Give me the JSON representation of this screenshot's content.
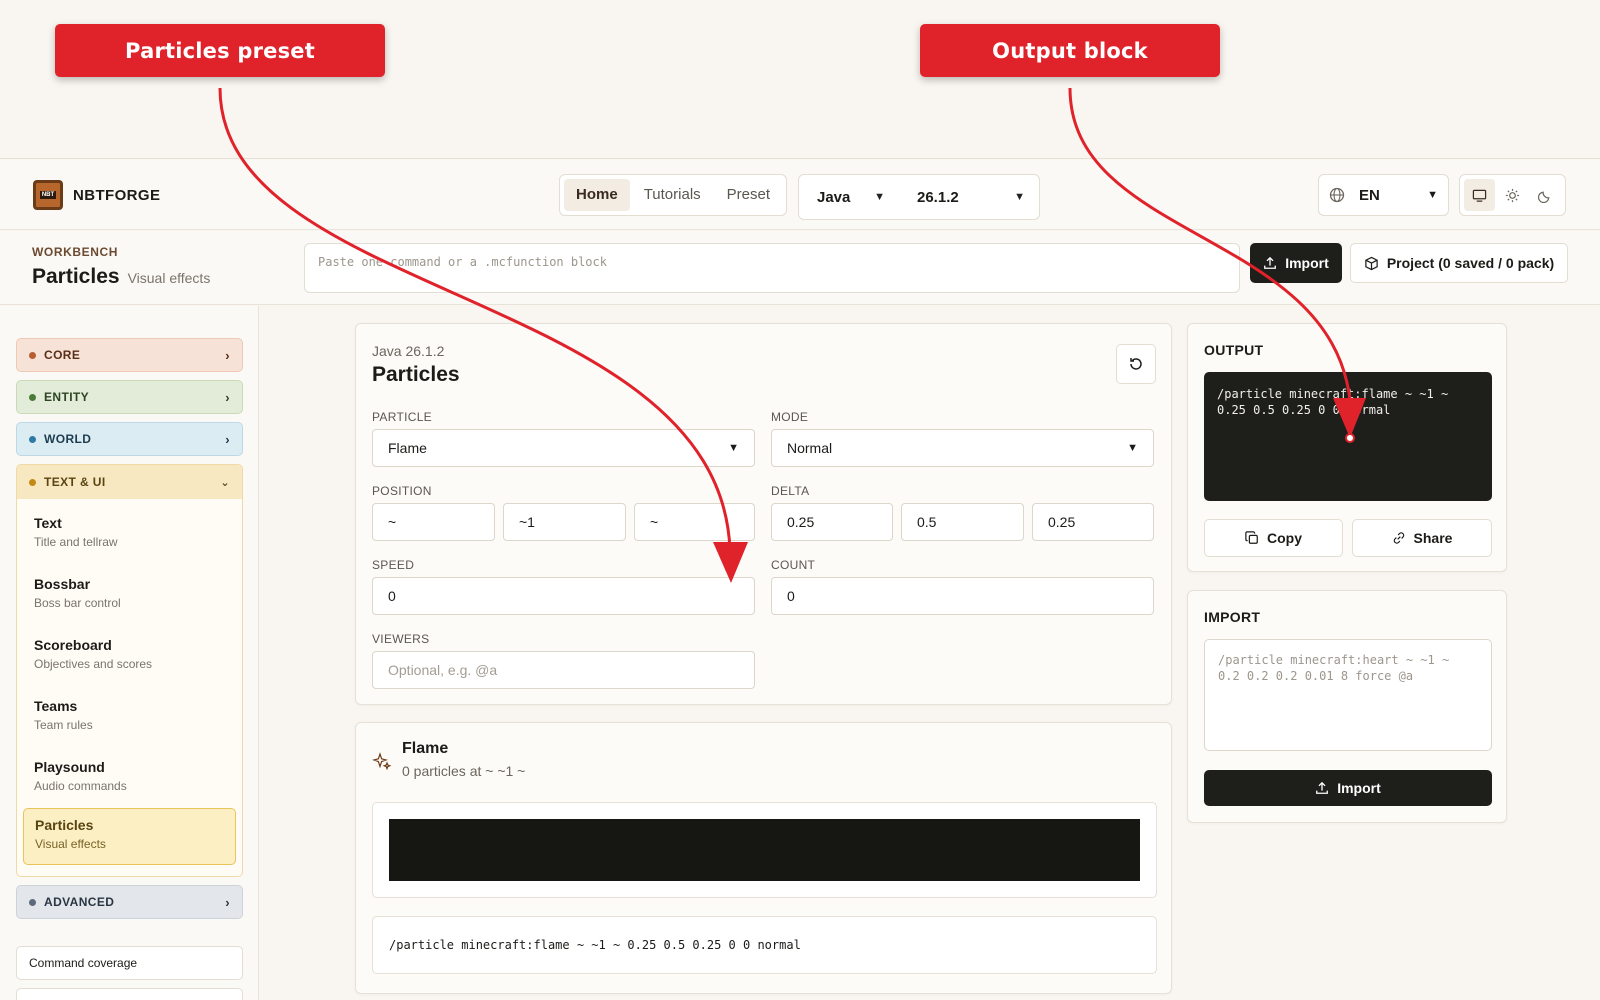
{
  "annotations": {
    "callout_1": "Particles preset",
    "callout_2": "Output block"
  },
  "colors": {
    "callout_red": "#e0222b",
    "dark": "#1e1e1b",
    "accent_brown": "#6b3a16"
  },
  "header": {
    "brand_logo_text": "NBT",
    "brand_name": "NBTFORGE",
    "nav_tabs": [
      {
        "label": "Home",
        "active": true
      },
      {
        "label": "Tutorials",
        "active": false
      },
      {
        "label": "Preset",
        "active": false
      }
    ],
    "edition": "Java",
    "version": "26.1.2",
    "language": "EN",
    "theme_modes": [
      "monitor-icon",
      "sun-icon",
      "moon-icon"
    ]
  },
  "workbench": {
    "label": "WORKBENCH",
    "title": "Particles",
    "subtitle": "Visual effects",
    "paste_placeholder": "Paste one command or a .mcfunction block",
    "import_label": "Import",
    "project_label": "Project (0 saved / 0 pack)"
  },
  "sidebar": {
    "categories": [
      {
        "label": "CORE"
      },
      {
        "label": "ENTITY"
      },
      {
        "label": "WORLD"
      },
      {
        "label": "TEXT & UI"
      },
      {
        "label": "ADVANCED"
      }
    ],
    "items": [
      {
        "name": "Text",
        "desc": "Title and tellraw"
      },
      {
        "name": "Bossbar",
        "desc": "Boss bar control"
      },
      {
        "name": "Scoreboard",
        "desc": "Objectives and scores"
      },
      {
        "name": "Teams",
        "desc": "Team rules"
      },
      {
        "name": "Playsound",
        "desc": "Audio commands"
      },
      {
        "name": "Particles",
        "desc": "Visual effects",
        "active": true
      }
    ],
    "footer_links": [
      "Command coverage",
      "Project (0 saved / 0 pack)"
    ]
  },
  "editor": {
    "version": "Java 26.1.2",
    "title": "Particles",
    "particle_label": "PARTICLE",
    "particle_value": "Flame",
    "mode_label": "MODE",
    "mode_value": "Normal",
    "position_label": "POSITION",
    "position": [
      "~",
      "~1",
      "~"
    ],
    "delta_label": "DELTA",
    "delta": [
      "0.25",
      "0.5",
      "0.25"
    ],
    "speed_label": "SPEED",
    "speed": "0",
    "count_label": "COUNT",
    "count": "0",
    "viewers_label": "VIEWERS",
    "viewers_placeholder": "Optional, e.g. @a"
  },
  "preview": {
    "title": "Flame",
    "subtitle": "0 particles at ~ ~1 ~",
    "command": "/particle minecraft:flame ~ ~1 ~ 0.25 0.5 0.25 0 0 normal"
  },
  "output": {
    "title": "OUTPUT",
    "code_line1": "/particle minecraft:flame ~ ~1 ~",
    "code_line2": "0.25 0.5 0.25 0 0 normal",
    "copy_label": "Copy",
    "share_label": "Share"
  },
  "import": {
    "title": "IMPORT",
    "placeholder": "/particle minecraft:heart ~ ~1 ~ 0.2 0.2 0.2 0.01 8 force @a",
    "button_label": "Import"
  }
}
